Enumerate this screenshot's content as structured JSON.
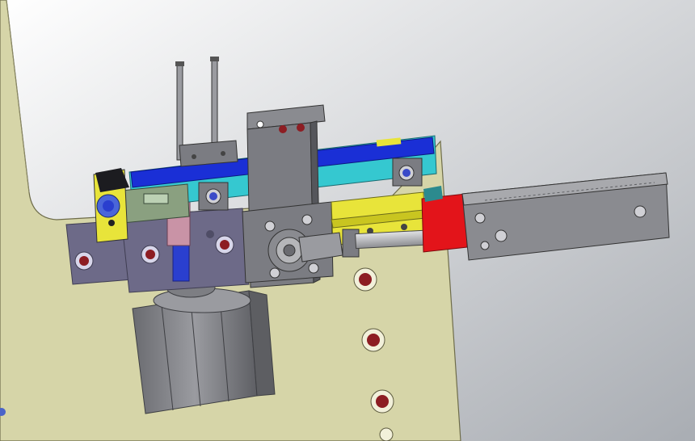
{
  "viewport": {
    "background_top": "#ffffff",
    "background_bottom": "#a9adb3"
  },
  "colors": {
    "base_plate": "#d6d5a8",
    "base_plate_edge": "#6e6c4a",
    "block_purple": "#6d6a88",
    "block_purple_dark": "#4f4d66",
    "block_grey": "#7b7c82",
    "block_grey_dark": "#55565b",
    "cylinder_grey": "#8a8b90",
    "rail_blue": "#1a2fd6",
    "rail_cyan": "#35c8d0",
    "slide_yellow": "#e8e43a",
    "stop_red": "#e3141a",
    "rod_pink": "#c993a6",
    "rod_blue": "#2a3fcf",
    "spring_blue": "#4a66d9",
    "hole_red": "#8d1d23",
    "rod_steel": "#b5b6b9"
  },
  "components": [
    "base-plate",
    "vertical-cylinder",
    "mounting-block",
    "linear-rail",
    "carriage-block",
    "guide-rod-pair",
    "pink-plunger",
    "spring-clamp",
    "slide-table",
    "rod-end-joint",
    "horizontal-cylinder",
    "red-stop-block"
  ]
}
